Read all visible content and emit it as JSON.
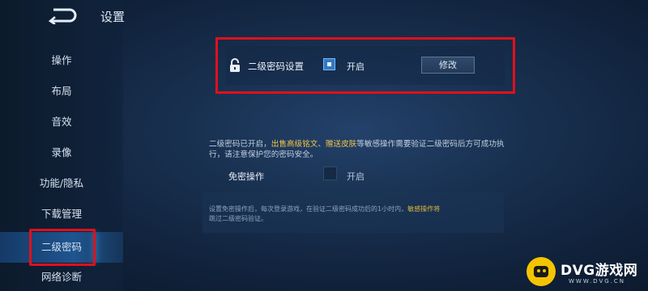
{
  "header": {
    "title": "设置"
  },
  "sidebar": {
    "items": [
      {
        "label": ""
      },
      {
        "label": "操作"
      },
      {
        "label": "布局"
      },
      {
        "label": "音效"
      },
      {
        "label": "录像"
      },
      {
        "label": "功能/隐私"
      },
      {
        "label": "下载管理"
      },
      {
        "label": "二级密码",
        "active": true
      },
      {
        "label": "网络诊断"
      }
    ]
  },
  "password": {
    "label": "二级密码设置",
    "checkbox_checked": true,
    "on_label": "开启",
    "modify_label": "修改"
  },
  "description": {
    "part1": "二级密码已开启，",
    "hl1": "出售高级铭文",
    "sep": "、",
    "hl2": "赠送皮肤",
    "part2": "等敏感操作需要验证二级密码后方可成功执行，请注意保护您的密码安全。"
  },
  "free_op": {
    "label": "免密操作",
    "checkbox_checked": false,
    "on_label": "开启"
  },
  "info": {
    "part1": "设置免密操作后，每次登录游戏，在验证二级密码成功后的1小时内，",
    "hl": "敏感操作将",
    "part2": "跳过二级密码验证。"
  },
  "watermark": {
    "title": "DVG游戏网",
    "subtitle": "WWW.DVG.CN"
  },
  "colors": {
    "highlight_border": "#e0101c",
    "accent": "#2f79c7",
    "warning_text": "#f0c44a"
  }
}
